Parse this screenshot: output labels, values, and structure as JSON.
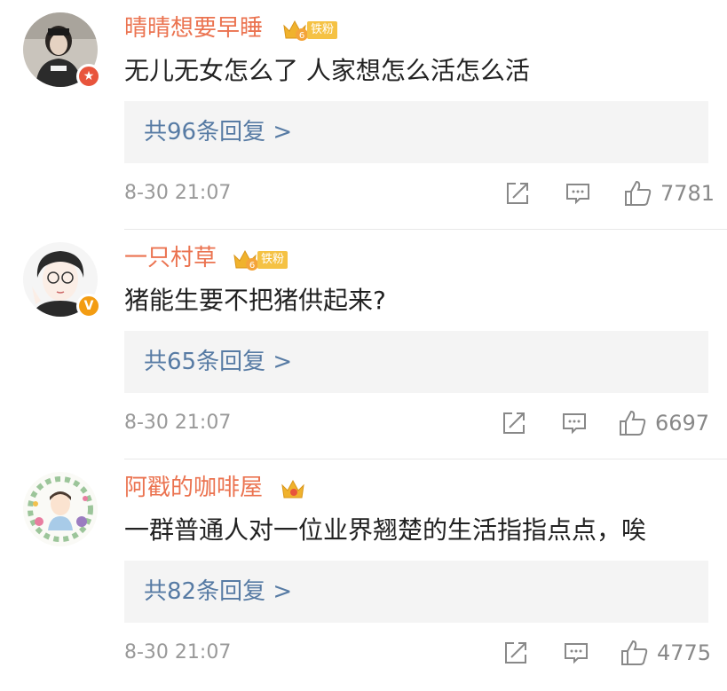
{
  "accent_color": "#eb7350",
  "link_color": "#577ba4",
  "comments": [
    {
      "username": "晴晴想要早睡",
      "badge_level": "6",
      "fan_label": "铁粉",
      "verify": "star",
      "text": "无儿无女怎么了 人家想怎么活怎么活",
      "replies": "共96条回复 >",
      "time": "8-30 21:07",
      "likes": "7781"
    },
    {
      "username": "一只村草",
      "badge_level": "6",
      "fan_label": "铁粉",
      "verify": "V",
      "text": "猪能生要不把猪供起来?",
      "replies": "共65条回复 >",
      "time": "8-30 21:07",
      "likes": "6697"
    },
    {
      "username": "阿戳的咖啡屋",
      "badge_level": "",
      "fan_label": "",
      "verify": "",
      "text": "一群普通人对一位业界翘楚的生活指指点点，唉",
      "replies": "共82条回复 >",
      "time": "8-30 21:07",
      "likes": "4775"
    }
  ]
}
